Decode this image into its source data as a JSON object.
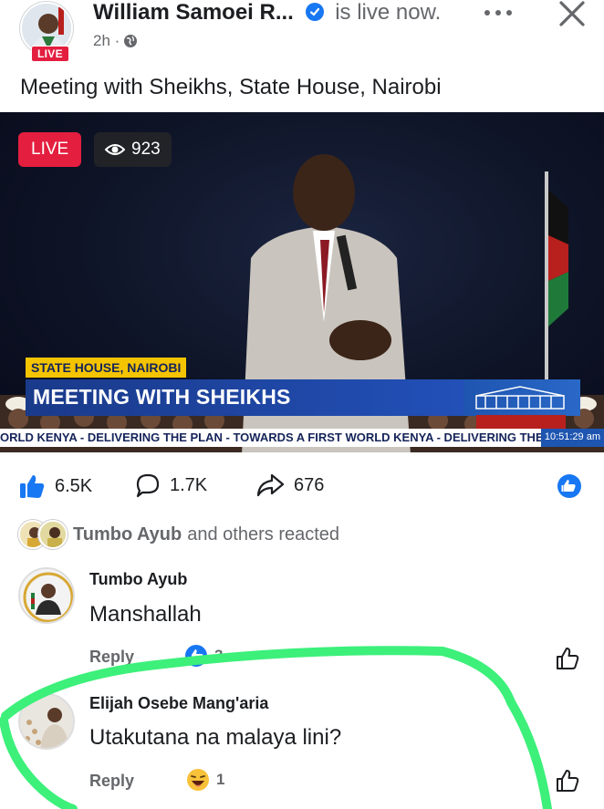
{
  "post": {
    "author": "William Samoei R...",
    "status": "is live now.",
    "time": "2h ·",
    "avatar_badge": "LIVE",
    "caption": "Meeting with Sheikhs, State House, Nairobi",
    "more_icon": "more-dots-icon",
    "close_icon": "close-icon",
    "privacy_icon": "globe-icon"
  },
  "video": {
    "live_label": "LIVE",
    "viewers": "923",
    "location_tag": "STATE HOUSE, NAIROBI",
    "headline": "MEETING WITH SHEIKHS",
    "ticker": "ORLD KENYA - DELIVERING THE PLAN - TOWARDS A FIRST WORLD KENYA - DELIVERING THE",
    "clock": "10:51:29 am"
  },
  "actions": {
    "likes": "6.5K",
    "comments": "1.7K",
    "shares": "676"
  },
  "reactions": {
    "name": "Tumbo Ayub",
    "text": "and others reacted"
  },
  "comments": [
    {
      "name": "Tumbo Ayub",
      "body": "Manshallah",
      "reply_label": "Reply",
      "reaction_count": "3"
    },
    {
      "name": "Elijah Osebe Mang'aria",
      "body": "Utakutana na malaya lini?",
      "reply_label": "Reply",
      "reaction_count": "1"
    }
  ],
  "colors": {
    "live_red": "#e41e3f",
    "facebook_blue": "#1877f2",
    "highlight_green": "#3cf07a"
  }
}
